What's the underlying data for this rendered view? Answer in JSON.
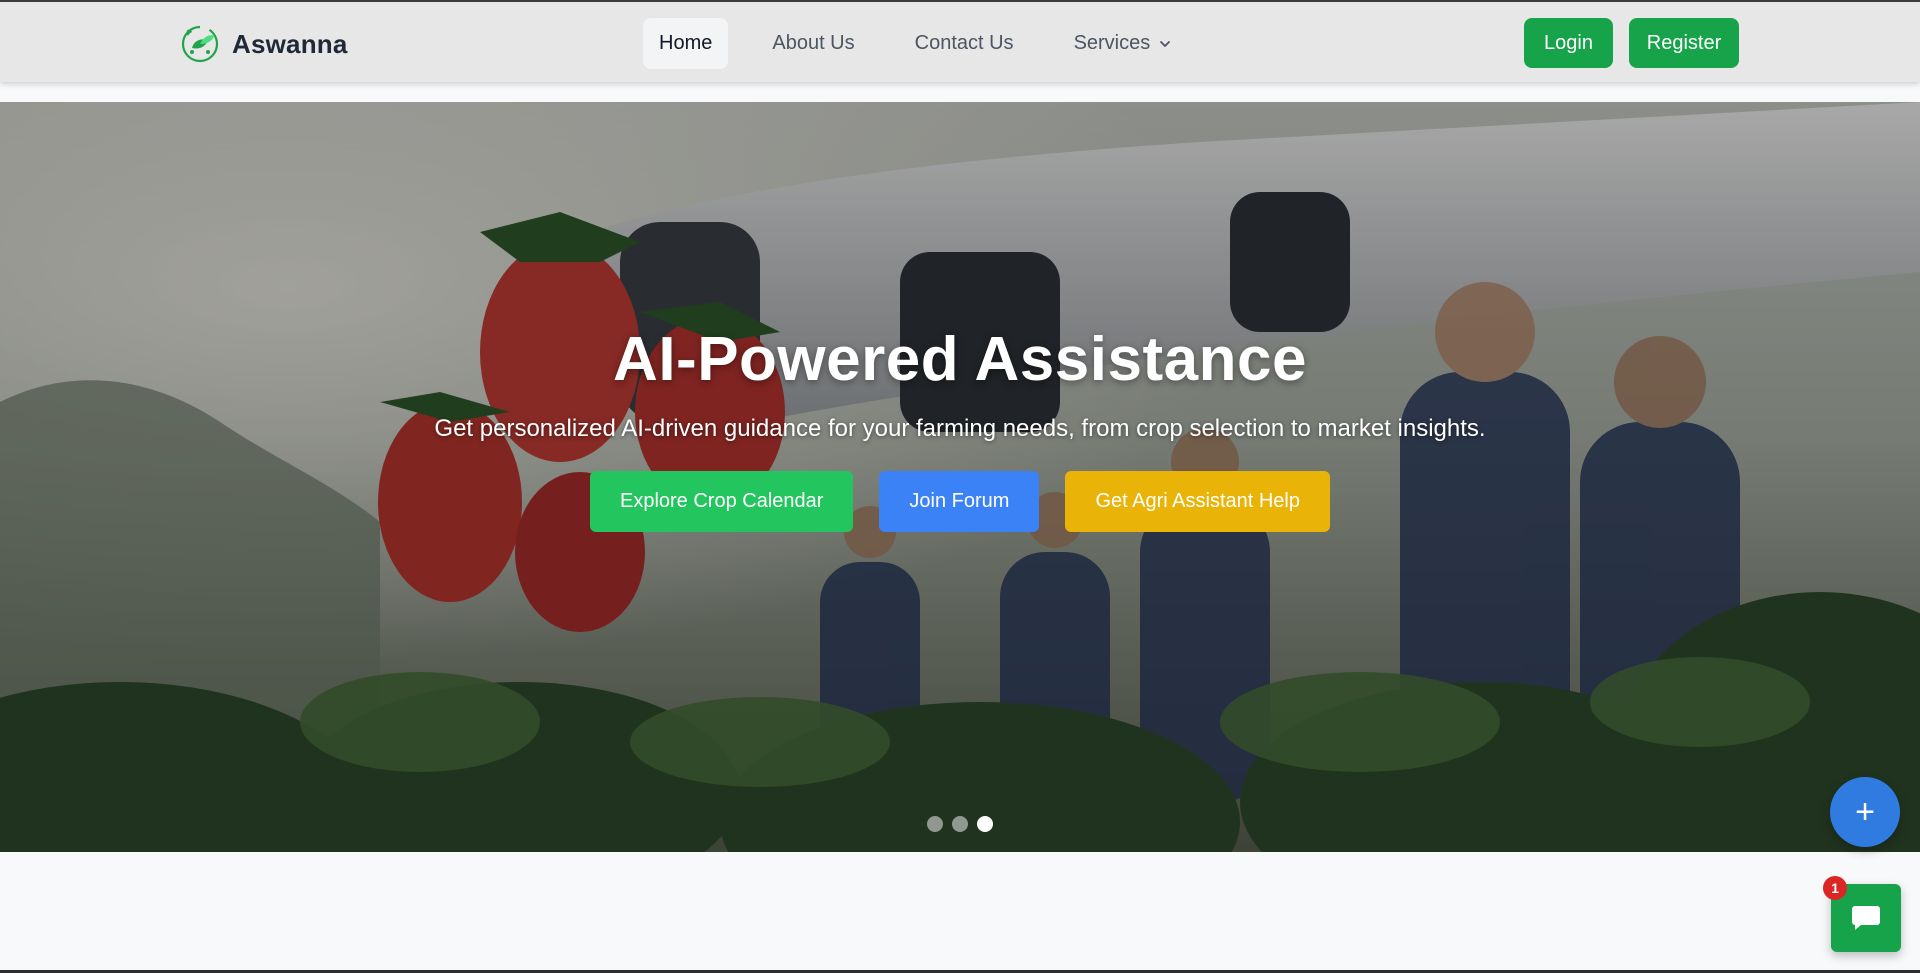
{
  "brand": {
    "name": "Aswanna",
    "logo_icon": "leaf-logo-icon",
    "accent": "#16a34a"
  },
  "nav": {
    "items": [
      {
        "label": "Home",
        "active": true
      },
      {
        "label": "About Us",
        "active": false
      },
      {
        "label": "Contact Us",
        "active": false
      },
      {
        "label": "Services",
        "active": false,
        "has_dropdown": true
      }
    ]
  },
  "auth": {
    "login_label": "Login",
    "register_label": "Register"
  },
  "hero": {
    "title": "AI-Powered Assistance",
    "subtitle": "Get personalized AI-driven guidance for your farming needs, from crop selection to market insights.",
    "buttons": [
      {
        "label": "Explore Crop Calendar",
        "color": "#22c55e"
      },
      {
        "label": "Join Forum",
        "color": "#3b82f6"
      },
      {
        "label": "Get Agri Assistant Help",
        "color": "#eab308"
      }
    ],
    "carousel": {
      "slides": 3,
      "active_index": 2
    }
  },
  "fab": {
    "icon": "plus-icon",
    "color": "#2f7be0"
  },
  "chat": {
    "icon": "chat-bubble-icon",
    "badge_count": "1",
    "color": "#16a34a"
  }
}
